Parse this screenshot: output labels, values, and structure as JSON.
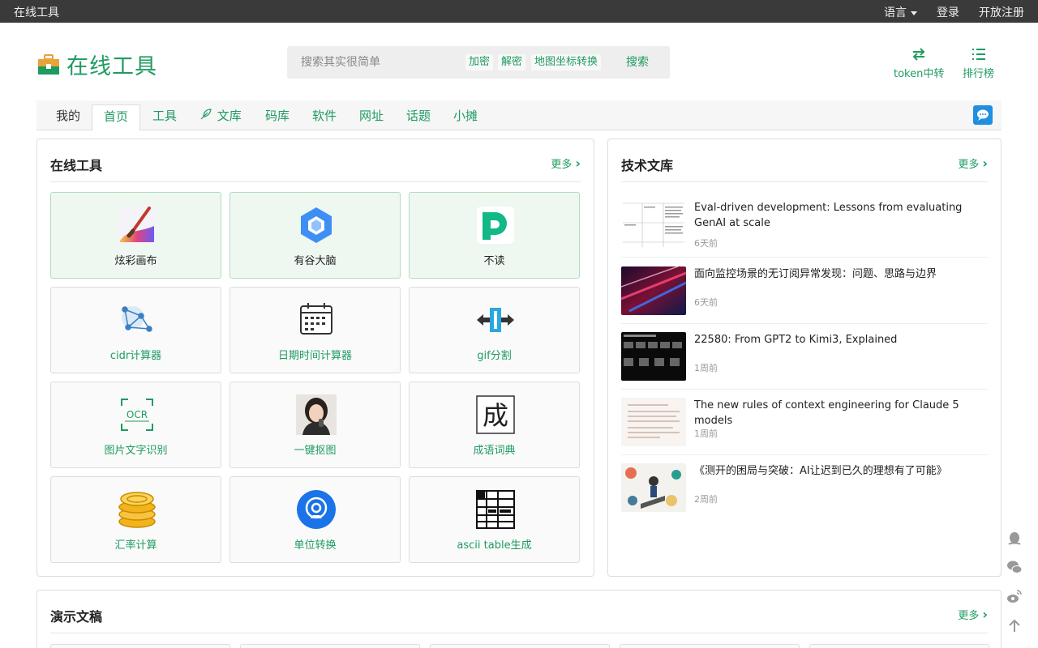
{
  "topbar": {
    "site_name": "在线工具",
    "language": "语言",
    "login": "登录",
    "register": "开放注册"
  },
  "header": {
    "logo_text": "在线工具",
    "search": {
      "placeholder": "搜索其实很简单",
      "tags": [
        "加密",
        "解密",
        "地图坐标转换"
      ],
      "button": "搜索"
    },
    "token_relay": "token中转",
    "ranking": "排行榜"
  },
  "nav": {
    "tabs": [
      {
        "label": "我的"
      },
      {
        "label": "首页"
      },
      {
        "label": "工具"
      },
      {
        "label": "文库"
      },
      {
        "label": "码库"
      },
      {
        "label": "软件"
      },
      {
        "label": "网址"
      },
      {
        "label": "话题"
      },
      {
        "label": "小摊"
      }
    ],
    "active": "首页"
  },
  "tools_panel": {
    "title": "在线工具",
    "more": "更多",
    "tools": [
      {
        "name": "炫彩画布",
        "icon": "paint-brush-icon"
      },
      {
        "name": "有谷大脑",
        "icon": "hexagon-icon"
      },
      {
        "name": "不读",
        "icon": "bu-du-icon"
      },
      {
        "name": "cidr计算器",
        "icon": "network-icon"
      },
      {
        "name": "日期时间计算器",
        "icon": "calendar-icon"
      },
      {
        "name": "gif分割",
        "icon": "split-icon"
      },
      {
        "name": "图片文字识别",
        "icon": "ocr-icon",
        "icon_text": "OCR"
      },
      {
        "name": "一键抠图",
        "icon": "portrait-icon"
      },
      {
        "name": "成语词典",
        "icon": "idiom-icon",
        "icon_text": "成"
      },
      {
        "name": "汇率计算",
        "icon": "coins-icon"
      },
      {
        "name": "单位转换",
        "icon": "unit-icon"
      },
      {
        "name": "ascii table生成",
        "icon": "table-icon"
      }
    ]
  },
  "docs_panel": {
    "title": "技术文库",
    "more": "更多",
    "docs": [
      {
        "title": "Eval-driven development: Lessons from evaluating GenAI at scale",
        "time": "6天前"
      },
      {
        "title": "面向监控场景的无订阅异常发现：问题、思路与边界",
        "time": "6天前"
      },
      {
        "title": "22580: From GPT2 to Kimi3, Explained",
        "time": "1周前"
      },
      {
        "title": "The new rules of context engineering for Claude 5 models",
        "time": "1周前"
      },
      {
        "title": "《测开的困局与突破：AI让迟到已久的理想有了可能》",
        "time": "2周前"
      }
    ]
  },
  "demo_panel": {
    "title": "演示文稿",
    "more": "更多"
  },
  "colors": {
    "brand": "#1e9b61",
    "topbar": "#3a3a3a"
  }
}
